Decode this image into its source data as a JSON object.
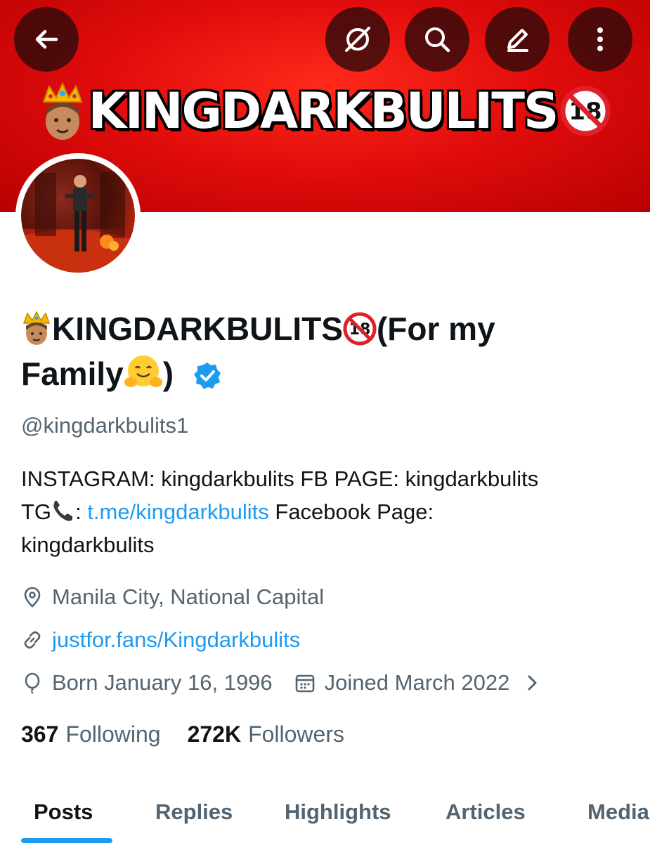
{
  "header": {
    "banner_text": "KINGDARKBULITS",
    "back_icon": "arrow-left-icon",
    "actions": [
      "incognito-icon",
      "search-icon",
      "edit-icon",
      "more-vertical-icon"
    ]
  },
  "profile": {
    "display_name_part1": "KINGDARKBULITS",
    "display_name_part2": "(For my",
    "display_name_part3": "Family",
    "display_name_part4": ")",
    "verified": true,
    "handle": "@kingdarkbulits1",
    "bio_line1": "INSTAGRAM: kingdarkbulits FB PAGE: kingdarkbulits",
    "bio_tg_prefix": "TG",
    "bio_tg_colon": ":",
    "bio_link": "t.me/kingdarkbulits",
    "bio_after_link": " Facebook Page:",
    "bio_line3": "kingdarkbulits",
    "location": "Manila City, National Capital",
    "website": "justfor.fans/Kingdarkbulits",
    "born": "Born January 16, 1996",
    "joined": "Joined March 2022"
  },
  "stats": {
    "following_count": "367",
    "following_label": "Following",
    "followers_count": "272K",
    "followers_label": "Followers"
  },
  "tabs": [
    "Posts",
    "Replies",
    "Highlights",
    "Articles",
    "Media"
  ],
  "colors": {
    "banner_red": "#e30d0d",
    "link_blue": "#1d9bf0",
    "verified_blue": "#1d9bf0",
    "secondary_text": "#536471",
    "primary_text": "#0f1419"
  }
}
